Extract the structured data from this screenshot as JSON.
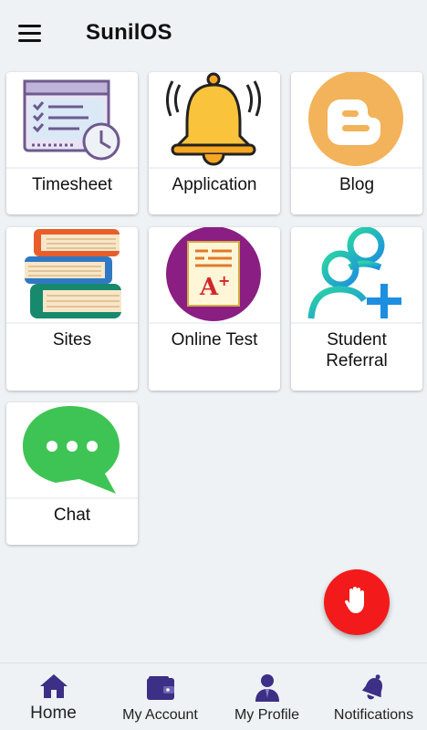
{
  "header": {
    "title": "SunilOS"
  },
  "tiles": [
    {
      "label": "Timesheet",
      "icon": "timesheet-icon"
    },
    {
      "label": "Application",
      "icon": "bell-icon"
    },
    {
      "label": "Blog",
      "icon": "blogger-icon"
    },
    {
      "label": "Sites",
      "icon": "books-icon"
    },
    {
      "label": "Online Test",
      "icon": "test-paper-icon"
    },
    {
      "label": "Student Referral",
      "icon": "add-user-icon"
    },
    {
      "label": "Chat",
      "icon": "chat-bubble-icon"
    }
  ],
  "fab": {
    "icon": "hand-icon",
    "color": "#f21a1a"
  },
  "bottom_nav": [
    {
      "label": "Home",
      "icon": "home-icon",
      "active": true
    },
    {
      "label": "My Account",
      "icon": "wallet-icon"
    },
    {
      "label": "My Profile",
      "icon": "profile-icon"
    },
    {
      "label": "Notifications",
      "icon": "notification-bell-icon"
    }
  ],
  "colors": {
    "accent": "#3b2f86",
    "background": "#eef2f5",
    "fab": "#f21a1a"
  }
}
